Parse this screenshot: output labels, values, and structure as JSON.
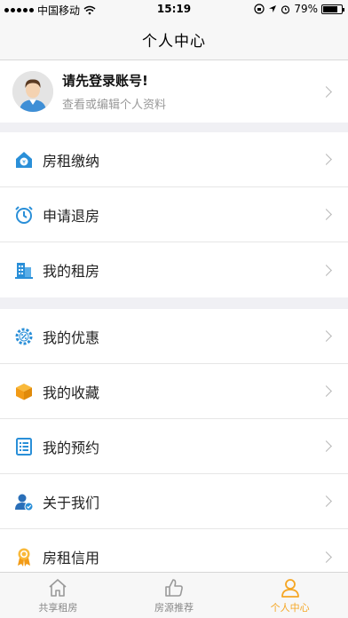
{
  "status_bar": {
    "carrier": "中国移动",
    "time": "15:19",
    "battery": "79%"
  },
  "nav": {
    "title": "个人中心"
  },
  "profile": {
    "title": "请先登录账号!",
    "subtitle": "查看或编辑个人资料"
  },
  "groups": [
    {
      "items": [
        {
          "label": "房租缴纳",
          "icon": "house-yen-icon"
        },
        {
          "label": "申请退房",
          "icon": "alarm-clock-icon"
        },
        {
          "label": "我的租房",
          "icon": "building-icon"
        }
      ]
    },
    {
      "items": [
        {
          "label": "我的优惠",
          "icon": "discount-gear-icon"
        },
        {
          "label": "我的收藏",
          "icon": "box-icon"
        },
        {
          "label": "我的预约",
          "icon": "list-document-icon"
        },
        {
          "label": "关于我们",
          "icon": "user-check-icon"
        },
        {
          "label": "房租信用",
          "icon": "award-badge-icon"
        }
      ]
    }
  ],
  "tabs": [
    {
      "label": "共享租房",
      "icon": "home-icon",
      "active": false
    },
    {
      "label": "房源推荐",
      "icon": "thumbs-up-icon",
      "active": false
    },
    {
      "label": "个人中心",
      "icon": "person-icon",
      "active": true
    }
  ],
  "colors": {
    "accent": "#f5a623",
    "icon_blue": "#2a8fd8"
  }
}
